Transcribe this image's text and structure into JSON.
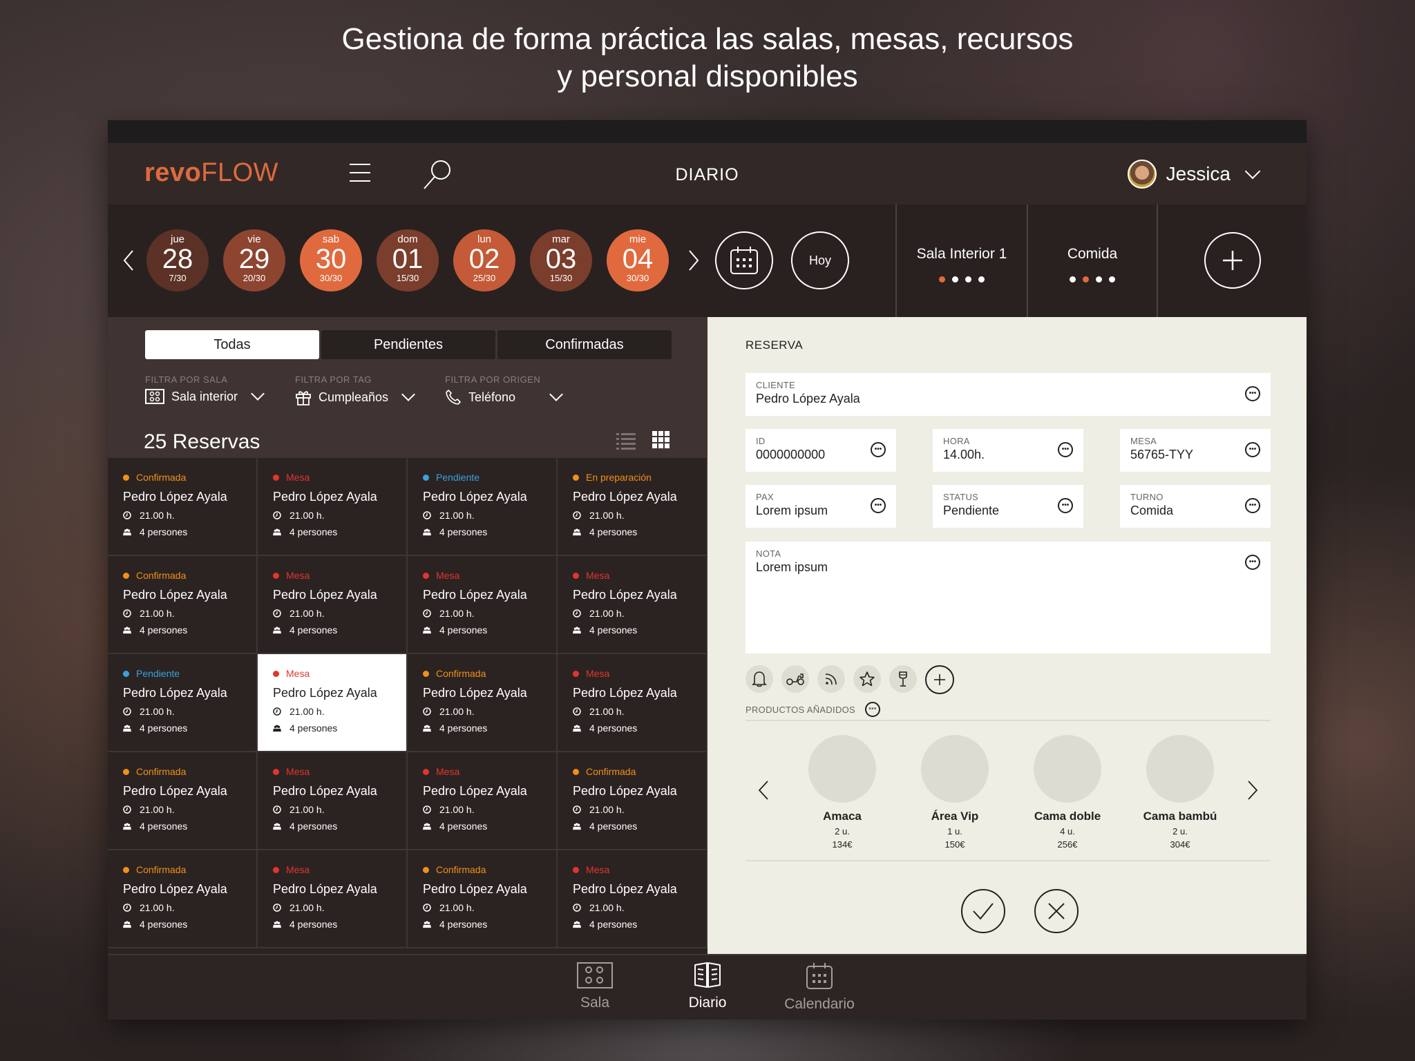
{
  "headline": {
    "line1": "Gestiona de forma práctica las salas, mesas, recursos",
    "line2": "y personal disponibles"
  },
  "header": {
    "logo_bold": "revo",
    "logo_light": "FLOW",
    "title": "DIARIO",
    "user_name": "Jessica",
    "menu_icon": "hamburger-icon",
    "search_icon": "search-icon"
  },
  "colors": {
    "accent": "#e06a3e",
    "confirmada": "#f0901a",
    "mesa": "#e3342f",
    "pendiente": "#3aa0e0",
    "preparacion": "#f0901a"
  },
  "dates": [
    {
      "weekday": "jue",
      "day": "28",
      "occupancy": "7/30",
      "color": "#5c3226"
    },
    {
      "weekday": "vie",
      "day": "29",
      "occupancy": "20/30",
      "color": "#8e4530"
    },
    {
      "weekday": "sab",
      "day": "30",
      "occupancy": "30/30",
      "color": "#e06a3e"
    },
    {
      "weekday": "dom",
      "day": "01",
      "occupancy": "15/30",
      "color": "#7b3d2c"
    },
    {
      "weekday": "lun",
      "day": "02",
      "occupancy": "25/30",
      "color": "#c45a37"
    },
    {
      "weekday": "mar",
      "day": "03",
      "occupancy": "15/30",
      "color": "#7b3d2c"
    },
    {
      "weekday": "mie",
      "day": "04",
      "occupancy": "30/30",
      "color": "#e06a3e"
    }
  ],
  "datebar": {
    "today_label": "Hoy",
    "room_label": "Sala Interior 1",
    "room_page": 1,
    "room_pages": 4,
    "shift_label": "Comida",
    "shift_page": 2,
    "shift_pages": 4
  },
  "filters": {
    "tabs": [
      "Todas",
      "Pendientes",
      "Confirmadas"
    ],
    "active_tab": "Todas",
    "sala_label": "FILTRA POR SALA",
    "sala_value": "Sala interior",
    "tag_label": "FILTRA POR TAG",
    "tag_value": "Cumpleaños",
    "origen_label": "FILTRA POR ORIGEN",
    "origen_value": "Teléfono"
  },
  "reservations": {
    "count_label": "25 Reservas",
    "items": [
      {
        "status": "Confirmada",
        "kind": "confirmada",
        "name": "Pedro López Ayala",
        "time": "21.00 h.",
        "people": "4 persones"
      },
      {
        "status": "Mesa",
        "kind": "mesa",
        "name": "Pedro López Ayala",
        "time": "21.00 h.",
        "people": "4 persones"
      },
      {
        "status": "Pendiente",
        "kind": "pendiente",
        "name": "Pedro López Ayala",
        "time": "21.00 h.",
        "people": "4 persones"
      },
      {
        "status": "En preparación",
        "kind": "preparacion",
        "name": "Pedro López Ayala",
        "time": "21.00 h.",
        "people": "4 persones"
      },
      {
        "status": "Confirmada",
        "kind": "confirmada",
        "name": "Pedro López Ayala",
        "time": "21.00 h.",
        "people": "4 persones"
      },
      {
        "status": "Mesa",
        "kind": "mesa",
        "name": "Pedro López Ayala",
        "time": "21.00 h.",
        "people": "4 persones"
      },
      {
        "status": "Mesa",
        "kind": "mesa",
        "name": "Pedro López Ayala",
        "time": "21.00 h.",
        "people": "4 persones"
      },
      {
        "status": "Mesa",
        "kind": "mesa",
        "name": "Pedro López Ayala",
        "time": "21.00 h.",
        "people": "4 persones"
      },
      {
        "status": "Pendiente",
        "kind": "pendiente",
        "name": "Pedro López Ayala",
        "time": "21.00 h.",
        "people": "4 persones"
      },
      {
        "status": "Mesa",
        "kind": "mesa",
        "name": "Pedro López Ayala",
        "time": "21.00 h.",
        "people": "4 persones",
        "selected": true
      },
      {
        "status": "Confirmada",
        "kind": "confirmada",
        "name": "Pedro López Ayala",
        "time": "21.00 h.",
        "people": "4 persones"
      },
      {
        "status": "Mesa",
        "kind": "mesa",
        "name": "Pedro López Ayala",
        "time": "21.00 h.",
        "people": "4 persones"
      },
      {
        "status": "Confirmada",
        "kind": "confirmada",
        "name": "Pedro López Ayala",
        "time": "21.00 h.",
        "people": "4 persones"
      },
      {
        "status": "Mesa",
        "kind": "mesa",
        "name": "Pedro López Ayala",
        "time": "21.00 h.",
        "people": "4 persones"
      },
      {
        "status": "Mesa",
        "kind": "mesa",
        "name": "Pedro López Ayala",
        "time": "21.00 h.",
        "people": "4 persones"
      },
      {
        "status": "Confirmada",
        "kind": "confirmada",
        "name": "Pedro López Ayala",
        "time": "21.00 h.",
        "people": "4 persones"
      },
      {
        "status": "Confirmada",
        "kind": "confirmada",
        "name": "Pedro López Ayala",
        "time": "21.00 h.",
        "people": "4 persones"
      },
      {
        "status": "Mesa",
        "kind": "mesa",
        "name": "Pedro López Ayala",
        "time": "21.00 h.",
        "people": "4 persones"
      },
      {
        "status": "Confirmada",
        "kind": "confirmada",
        "name": "Pedro López Ayala",
        "time": "21.00 h.",
        "people": "4 persones"
      },
      {
        "status": "Mesa",
        "kind": "mesa",
        "name": "Pedro López Ayala",
        "time": "21.00 h.",
        "people": "4 persones"
      }
    ]
  },
  "reserva": {
    "title": "RESERVA",
    "cliente_label": "CLIENTE",
    "cliente_value": "Pedro López Ayala",
    "id_label": "ID",
    "id_value": "0000000000",
    "hora_label": "HORA",
    "hora_value": "14.00h.",
    "mesa_label": "MESA",
    "mesa_value": "56765-TYY",
    "pax_label": "PAX",
    "pax_value": "Lorem ipsum",
    "status_label": "STATUS",
    "status_value": "Pendiente",
    "turno_label": "TURNO",
    "turno_value": "Comida",
    "nota_label": "NOTA",
    "nota_value": "Lorem ipsum",
    "tag_icons": [
      "bell-icon",
      "scooter-icon",
      "rss-icon",
      "star-icon",
      "wine-glass-icon"
    ],
    "productos_label": "PRODUCTOS AÑADIDOS",
    "productos": [
      {
        "name": "Amaca",
        "qty": "2 u.",
        "price": "134€"
      },
      {
        "name": "Área Vip",
        "qty": "1 u.",
        "price": "150€"
      },
      {
        "name": "Cama doble",
        "qty": "4 u.",
        "price": "256€"
      },
      {
        "name": "Cama bambú",
        "qty": "2 u.",
        "price": "304€"
      }
    ]
  },
  "tabbar": {
    "tabs": [
      {
        "label": "Sala",
        "icon": "room-icon"
      },
      {
        "label": "Diario",
        "icon": "book-icon"
      },
      {
        "label": "Calendario",
        "icon": "calendar-icon"
      }
    ],
    "active": "Diario"
  }
}
